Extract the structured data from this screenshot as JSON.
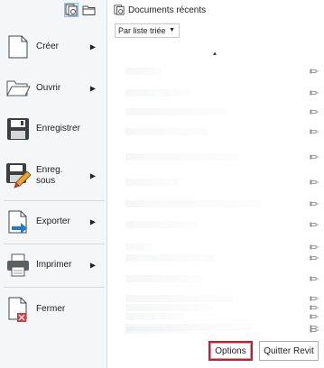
{
  "menu": {
    "items": [
      {
        "label": "Créer",
        "has_submenu": true
      },
      {
        "label": "Ouvrir",
        "has_submenu": true
      },
      {
        "label": "Enregistrer",
        "has_submenu": false
      },
      {
        "label": "Enreg.\nsous",
        "has_submenu": true
      },
      {
        "label": "Exporter",
        "has_submenu": true
      },
      {
        "label": "Imprimer",
        "has_submenu": true
      },
      {
        "label": "Fermer",
        "has_submenu": false
      }
    ],
    "arrow_glyph": "▶"
  },
  "recent": {
    "title": "Documents récents",
    "sort_value": "Par liste triée",
    "dropdown_glyph": "▼",
    "sort_direction_glyph": "▲",
    "pin_count": 16
  },
  "buttons": {
    "options_label": "Options",
    "quit_label": "Quitter Revit"
  },
  "colors": {
    "menu_bg": "#f5f6f7",
    "active_icon_bg": "#cde8ff",
    "focus_border": "#c21f2e",
    "accent_blue": "#1f7ad1"
  }
}
